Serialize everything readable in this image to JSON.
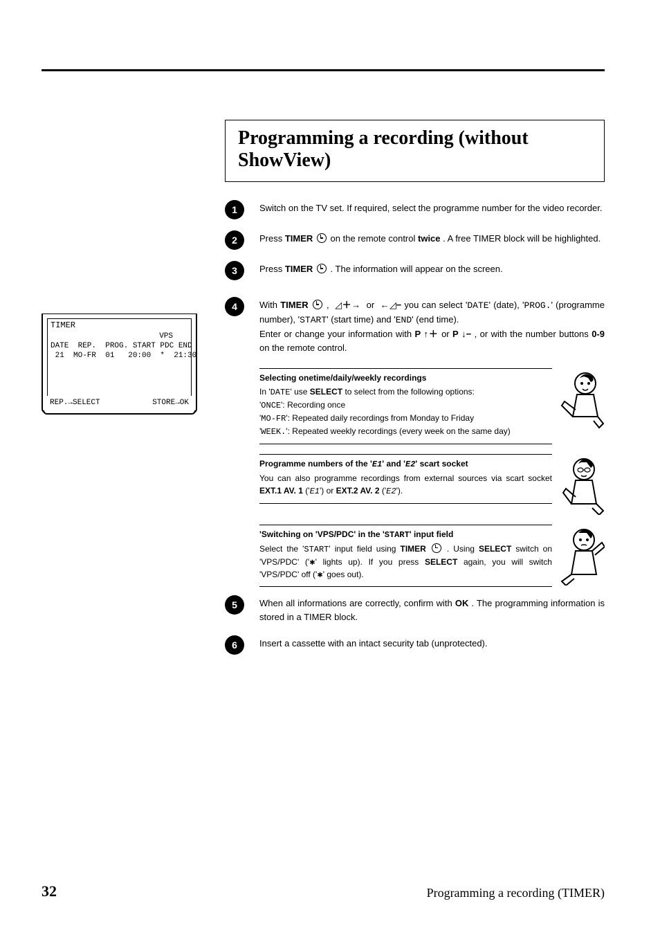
{
  "header": {
    "title": "Programming a recording (without ShowView)"
  },
  "screen": {
    "title": "TIMER",
    "vps": "VPS",
    "hdr": "DATE  REP.  PROG. START PDC END",
    "row": " 21  MO-FR  01   20:00  *  21:30",
    "left": "REP.→SELECT",
    "right": "STORE→OK"
  },
  "steps": {
    "s1": "Switch on the TV set. If required, select the programme number for the video recorder.",
    "s2a": "Press ",
    "s2_timer": "TIMER",
    "s2b": " on the remote control ",
    "s2_twice": "twice",
    "s2c": " . A free TIMER block will be highlighted.",
    "s3a": "Press ",
    "s3_timer": "TIMER",
    "s3b": " . The information will appear on the screen.",
    "s4a": "With ",
    "s4_timer": "TIMER",
    "s4b": " you can select '",
    "s4_date": "DATE",
    "s4c": "' (date), '",
    "s4_prog": "PROG.",
    "s4d": "' (programme number), '",
    "s4_start": "START",
    "s4e": "' (start time) and '",
    "s4_end": "END",
    "s4f": "' (end time).",
    "s4g": "Enter or change your information with ",
    "s4_pup": "P",
    "s4_or": " or ",
    "s4_pdn": "P",
    "s4h": " , or with the number buttons ",
    "s4_09": "0-9",
    "s4i": " on the remote control.",
    "s5a": "When all informations are correctly, confirm with ",
    "s5_ok": "OK",
    "s5b": " . The programming information is stored in a TIMER block.",
    "s6": "Insert a cassette with an intact security tab (unprotected)."
  },
  "box1": {
    "title": "Selecting onetime/daily/weekly recordings",
    "l1a": "In '",
    "l1_date": "DATE",
    "l1b": "' use ",
    "l1_select": "SELECT",
    "l1c": " to select from the following options:",
    "l2a": "'",
    "l2_once": "ONCE",
    "l2b": "': Recording once",
    "l3a": "'",
    "l3_mofr": "MO-FR",
    "l3b": "': Repeated daily recordings from Monday to Friday",
    "l4a": "'",
    "l4_week": "WEEK.",
    "l4b": "': Repeated weekly recordings (every week on the same day)"
  },
  "box2": {
    "titlea": "Programme numbers of the '",
    "title_e1": "E1",
    "titleb": "' and '",
    "title_e2": "E2",
    "titlec": "' scart socket",
    "l1": "You can also programme recordings from external sources via scart socket ",
    "l1_ext1": "EXT.1   AV. 1",
    "l1b": " ('",
    "l1_e1": "E1",
    "l1c": "') or ",
    "l1_ext2": "EXT.2  AV. 2",
    "l1d": " ('",
    "l1_e2": "E2",
    "l1e": "')."
  },
  "box3": {
    "titlea": "'Switching on 'VPS/PDC' in the '",
    "title_start": "START",
    "titleb": "' input field",
    "l1a": "Select the '",
    "l1_start": "START",
    "l1b": "' input field using ",
    "l1_timer": "TIMER",
    "l1c": " . Using ",
    "l1_select": "SELECT",
    "l1d": " switch on 'VPS/PDC' ('",
    "l1e": "' lights up). If you press ",
    "l1_select2": "SELECT",
    "l1f": " again, you will switch 'VPS/PDC' off ('",
    "l1g": "' goes out)."
  },
  "footer": {
    "page": "32",
    "section": "Programming a recording (TIMER)"
  }
}
